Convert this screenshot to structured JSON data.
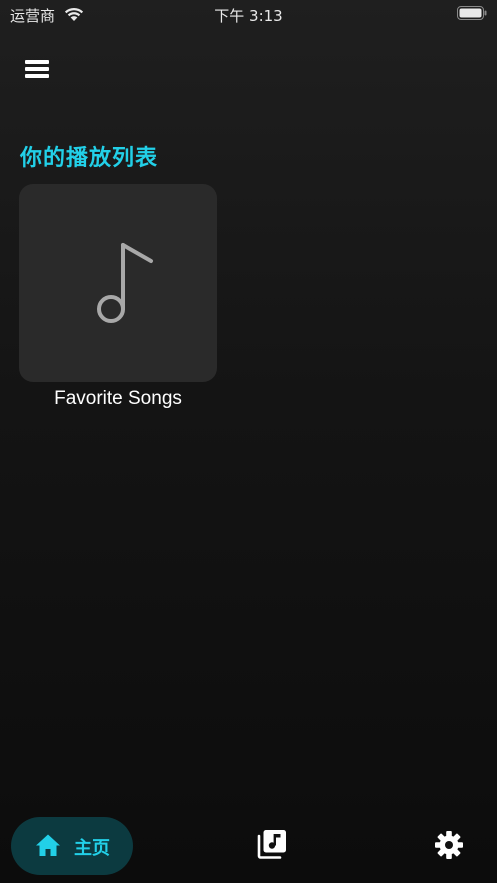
{
  "status_bar": {
    "carrier": "运营商",
    "time": "下午 3:13"
  },
  "header": {
    "menu_icon": "hamburger-menu-icon"
  },
  "main": {
    "section_title": "你的播放列表",
    "playlists": [
      {
        "name": "Favorite Songs",
        "icon": "music-note-icon"
      }
    ]
  },
  "tab_bar": {
    "tabs": [
      {
        "label": "主页",
        "icon": "home-icon",
        "active": true
      },
      {
        "label": "",
        "icon": "music-library-icon",
        "active": false
      },
      {
        "label": "",
        "icon": "gear-icon",
        "active": false
      }
    ]
  },
  "colors": {
    "accent": "#22d0e8",
    "active_tab_bg": "#0c3a40",
    "card_bg": "#2a2a2a",
    "background": "#141414"
  }
}
